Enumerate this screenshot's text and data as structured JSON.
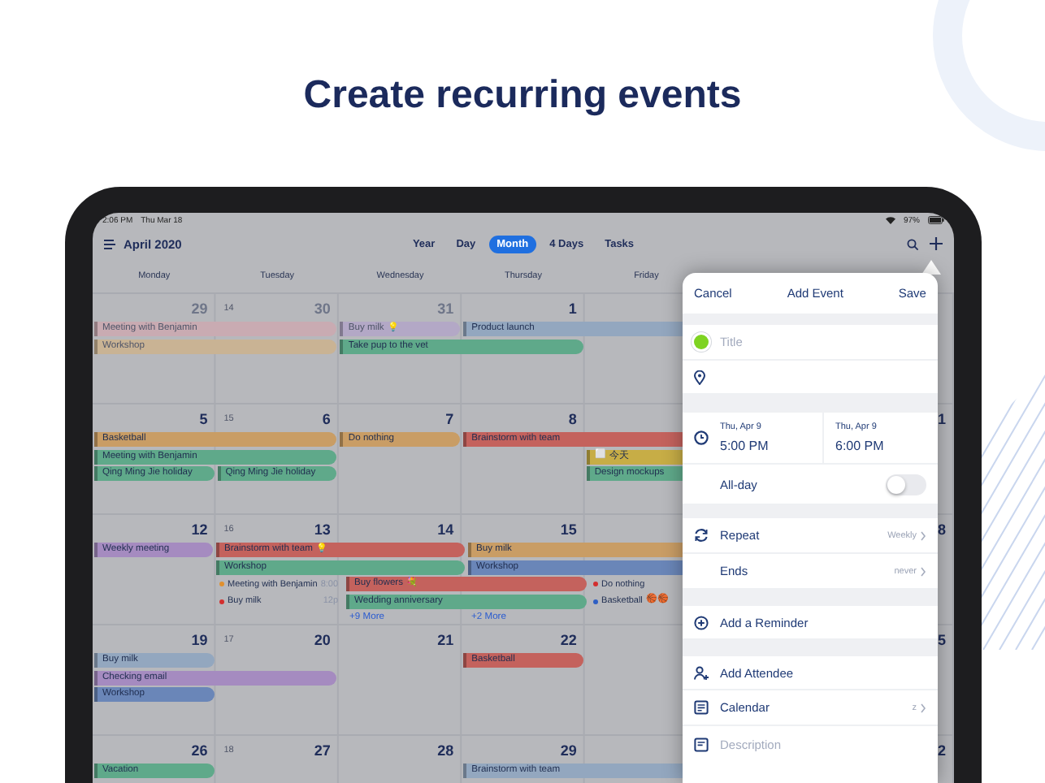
{
  "headline": "Create recurring events",
  "status_bar": {
    "time": "2:06 PM",
    "date": "Thu Mar 18",
    "battery": "97%"
  },
  "toolbar": {
    "month": "April 2020",
    "views": [
      {
        "label": "Year",
        "selected": false
      },
      {
        "label": "Day",
        "selected": false
      },
      {
        "label": "Month",
        "selected": true
      },
      {
        "label": "4 Days",
        "selected": false
      },
      {
        "label": "Tasks",
        "selected": false
      }
    ]
  },
  "weekdays": [
    "Monday",
    "Tuesday",
    "Wednesday",
    "Thursday",
    "Friday"
  ],
  "weeks": [
    {
      "week_number": "14",
      "days": [
        {
          "number": "29",
          "outside": true,
          "events": [
            {
              "kind": "bar",
              "label": "Meeting with Benjamin",
              "continues": true,
              "color": "#c9abb2",
              "faded": true
            },
            {
              "kind": "bar",
              "label": "Workshop",
              "continues": true,
              "color": "#c9b394",
              "faded": true
            }
          ]
        },
        {
          "number": "30",
          "outside": true
        },
        {
          "number": "31",
          "outside": true,
          "events": [
            {
              "kind": "bar",
              "label": "Buy milk",
              "continues": false,
              "color": "#b3a8c6",
              "faded": true,
              "emoji": "💡"
            },
            {
              "kind": "bar",
              "label": "Take pup to the vet",
              "continues": true,
              "color": "#5fa98a",
              "faded": false
            }
          ]
        },
        {
          "number": "1",
          "outside": false,
          "events": [
            {
              "kind": "bar",
              "label": "Product launch",
              "continues": true,
              "color": "#93a7bf",
              "faded": false
            }
          ]
        }
      ]
    },
    {
      "week_number": "15",
      "sunday_fragment": "1",
      "days": [
        {
          "number": "5",
          "outside": false,
          "events": [
            {
              "kind": "bar",
              "label": "Basketball",
              "continues": true,
              "color": "#c99d65",
              "faded": false
            },
            {
              "kind": "bar",
              "label": "Meeting with Benjamin",
              "continues": true,
              "color": "#5fa98a",
              "faded": false
            },
            {
              "kind": "bar",
              "label": "Qing Ming Jie holiday",
              "continues": false,
              "color": "#5fa98a",
              "faded": false
            }
          ]
        },
        {
          "number": "6",
          "outside": false,
          "events": [
            {
              "kind": "bar",
              "label": "Qing Ming Jie holiday",
              "continues": false,
              "color": "#5fa98a",
              "faded": false
            }
          ]
        },
        {
          "number": "7",
          "outside": false,
          "events": [
            {
              "kind": "bar",
              "label": "Do nothing",
              "continues": false,
              "color": "#c99d65",
              "faded": false
            }
          ]
        },
        {
          "number": "8",
          "outside": false,
          "events": [
            {
              "kind": "bar",
              "label": "Brainstorm with team",
              "continues": true,
              "color": "#c4625d",
              "faded": false
            }
          ]
        },
        {
          "events": [
            {
              "kind": "bar",
              "label": "今天",
              "prefix": "⬜",
              "continues": false,
              "color": "#c7ad46",
              "faded": false
            },
            {
              "kind": "bar",
              "label": "Design mockups",
              "continues": false,
              "color": "#5fa98a",
              "faded": false
            }
          ]
        }
      ]
    },
    {
      "week_number": "16",
      "sunday_fragment": "8",
      "days": [
        {
          "number": "12",
          "outside": false,
          "events": [
            {
              "kind": "bar",
              "label": "Weekly meeting",
              "continues": false,
              "color": "#a58bc0",
              "faded": false
            }
          ]
        },
        {
          "number": "13",
          "outside": false,
          "events": [
            {
              "kind": "bar",
              "label": "Brainstorm with team",
              "continues": true,
              "color": "#c4625d",
              "faded": false,
              "emoji": "💡"
            },
            {
              "kind": "bar",
              "label": "Workshop",
              "continues": true,
              "color": "#5fa98a",
              "faded": false
            },
            {
              "kind": "dot",
              "label": "Meeting with Benjamin",
              "color": "#e0902e",
              "time": "8:00"
            },
            {
              "kind": "dot",
              "label": "Buy milk",
              "color": "#d32f2f",
              "time": "12p"
            }
          ]
        },
        {
          "number": "14",
          "outside": false,
          "events": [
            {
              "kind": "bar",
              "label": "Buy flowers",
              "continues": true,
              "color": "#c4625d",
              "faded": false,
              "emoji": "💐"
            },
            {
              "kind": "bar",
              "label": "Wedding anniversary",
              "continues": true,
              "color": "#5fa98a",
              "faded": false
            },
            {
              "kind": "more",
              "label": "+9 More"
            }
          ]
        },
        {
          "number": "15",
          "outside": false,
          "events": [
            {
              "kind": "bar",
              "label": "Buy milk",
              "continues": true,
              "color": "#c99d65",
              "faded": false
            },
            {
              "kind": "bar",
              "label": "Workshop",
              "continues": true,
              "color": "#6a86b8",
              "faded": false
            },
            {
              "kind": "more",
              "label": "+2 More"
            }
          ]
        },
        {
          "events": [
            {
              "kind": "dot",
              "label": "Do nothing",
              "color": "#d32f2f"
            },
            {
              "kind": "dot",
              "label": "Basketball",
              "color": "#2f5fc4",
              "emoji": "🏀🏀"
            }
          ]
        }
      ]
    },
    {
      "week_number": "17",
      "sunday_fragment": "5",
      "days": [
        {
          "number": "19",
          "outside": false,
          "events": [
            {
              "kind": "bar",
              "label": "Buy milk",
              "continues": false,
              "color": "#93a7bf",
              "faded": false
            },
            {
              "kind": "bar",
              "label": "Checking email",
              "continues": true,
              "color": "#a58bc0",
              "faded": false
            },
            {
              "kind": "bar",
              "label": "Workshop",
              "continues": false,
              "color": "#6a86b8",
              "faded": false
            }
          ]
        },
        {
          "number": "20",
          "outside": false
        },
        {
          "number": "21",
          "outside": false
        },
        {
          "number": "22",
          "outside": false,
          "events": [
            {
              "kind": "bar",
              "label": "Basketball",
              "continues": false,
              "color": "#c4625d",
              "faded": false
            }
          ]
        }
      ]
    },
    {
      "week_number": "18",
      "sunday_fragment": "2",
      "days": [
        {
          "number": "26",
          "outside": false,
          "events": [
            {
              "kind": "bar",
              "label": "Vacation",
              "continues": false,
              "color": "#5fa98a",
              "faded": false
            }
          ]
        },
        {
          "number": "27",
          "outside": false
        },
        {
          "number": "28",
          "outside": false
        },
        {
          "number": "29",
          "outside": false,
          "events": [
            {
              "kind": "bar",
              "label": "Brainstorm with team",
              "continues": true,
              "color": "#93a7bf",
              "faded": false
            }
          ]
        }
      ]
    }
  ],
  "event_form": {
    "cancel": "Cancel",
    "title": "Add Event",
    "save": "Save",
    "title_field": {
      "placeholder": "Title",
      "color": "#7ed321"
    },
    "start": {
      "date": "Thu, Apr 9",
      "time": "5:00 PM"
    },
    "end": {
      "date": "Thu, Apr 9",
      "time": "6:00 PM"
    },
    "all_day": {
      "label": "All-day",
      "on": false
    },
    "repeat": {
      "label": "Repeat",
      "value": "Weekly"
    },
    "ends": {
      "label": "Ends",
      "value": "never"
    },
    "reminder": "Add a Reminder",
    "attendee": "Add Attendee",
    "calendar": {
      "label": "Calendar",
      "value": "z"
    },
    "description": {
      "placeholder": "Description"
    }
  }
}
